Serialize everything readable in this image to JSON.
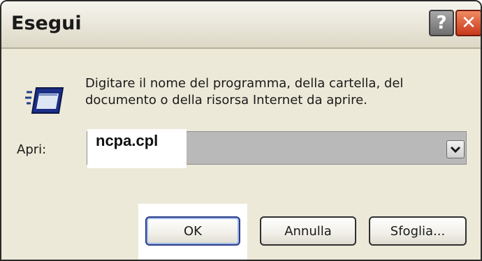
{
  "window": {
    "title": "Esegui",
    "help_button": "?",
    "close_button": "✕"
  },
  "dialog": {
    "prompt_line1": "Digitare il nome del programma, della cartella, del",
    "prompt_line2": "documento o della risorsa Internet da aprire.",
    "open_label": "Apri:",
    "open_value": "ncpa.cpl",
    "icon": "run-icon",
    "dropdown_icon": "chevron-down-icon"
  },
  "buttons": {
    "ok": "OK",
    "cancel": "Annulla",
    "browse": "Sfoglia..."
  }
}
